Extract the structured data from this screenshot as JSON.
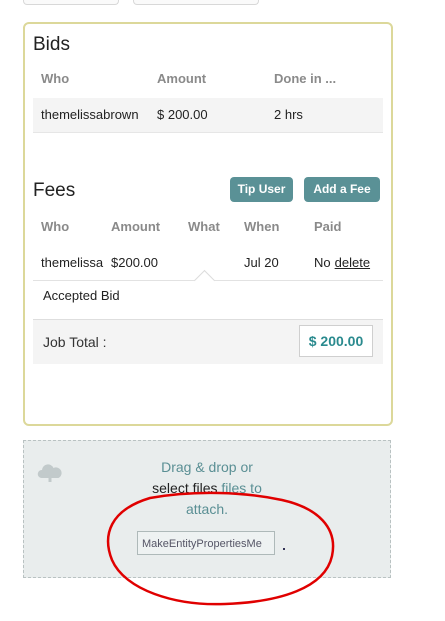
{
  "bids": {
    "title": "Bids",
    "columns": [
      "Who",
      "Amount",
      "Done in ..."
    ],
    "rows": [
      {
        "who": "themelissabrown",
        "amount": "$ 200.00",
        "done_in": "2 hrs"
      }
    ]
  },
  "fees": {
    "title": "Fees",
    "tip_button": "Tip User",
    "add_fee_button": "Add a Fee",
    "columns": [
      "Who",
      "Amount",
      "What",
      "When",
      "Paid"
    ],
    "rows": [
      {
        "who": "themelissa",
        "amount": "$200.00",
        "what": "",
        "when": "Jul 20",
        "paid": "No",
        "delete": "delete"
      }
    ],
    "accepted_note": "Accepted Bid",
    "job_total_label": "Job Total :",
    "job_total_value": "$ 200.00"
  },
  "dropzone": {
    "line1": "Drag & drop or",
    "select_files": "select files",
    "files_to": "files to",
    "line3": "attach.",
    "file_name": "MakeEntityPropertiesMe",
    "upload_icon": "cloud-upload-icon"
  },
  "colors": {
    "accent": "#5a9196",
    "panel_border": "#dcd89a",
    "total_text": "#2a8a8e",
    "annotation": "#e00000"
  }
}
